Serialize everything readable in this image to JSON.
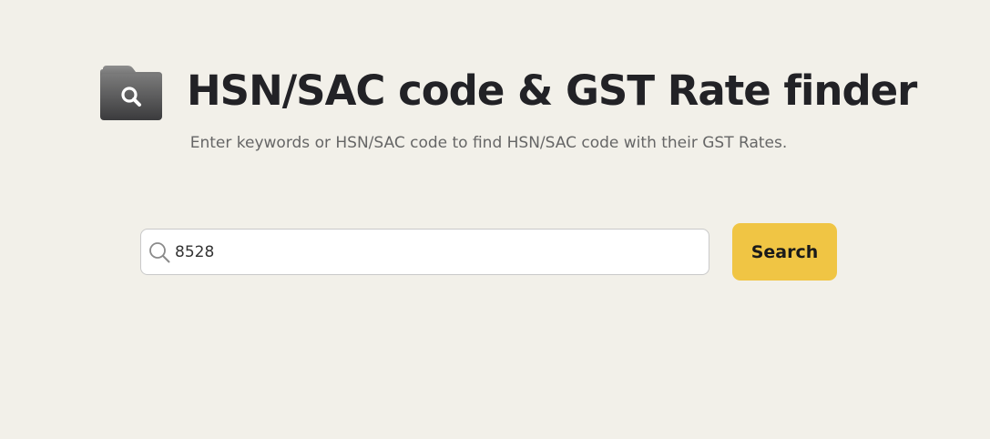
{
  "header": {
    "title": "HSN/SAC code & GST Rate finder",
    "logo_icon": "folder-search-icon"
  },
  "subtitle": "Enter keywords or HSN/SAC code to find HSN/SAC code with their GST Rates.",
  "search": {
    "value": "8528",
    "icon": "search-icon",
    "button_label": "Search"
  },
  "colors": {
    "background": "#f2f0e9",
    "button": "#f0c544",
    "title": "#222226",
    "subtitle": "#666666"
  }
}
